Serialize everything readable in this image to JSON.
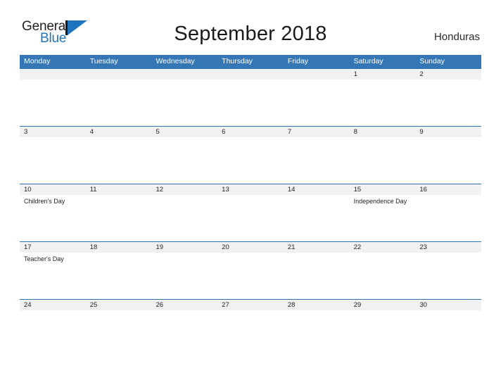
{
  "brand": {
    "name_part1": "General",
    "name_part2": "Blue",
    "mark_icon": "triangle-play-icon"
  },
  "header": {
    "title": "September 2018",
    "region": "Honduras"
  },
  "colors": {
    "header_blue": "#3576b4",
    "rule_blue": "#2e74b5",
    "date_band_gray": "#f1f1f1",
    "brand_blue": "#1f74bd"
  },
  "weekdays": [
    "Monday",
    "Tuesday",
    "Wednesday",
    "Thursday",
    "Friday",
    "Saturday",
    "Sunday"
  ],
  "weeks": [
    {
      "days": [
        {
          "date": "",
          "event": ""
        },
        {
          "date": "",
          "event": ""
        },
        {
          "date": "",
          "event": ""
        },
        {
          "date": "",
          "event": ""
        },
        {
          "date": "",
          "event": ""
        },
        {
          "date": "1",
          "event": ""
        },
        {
          "date": "2",
          "event": ""
        }
      ]
    },
    {
      "days": [
        {
          "date": "3",
          "event": ""
        },
        {
          "date": "4",
          "event": ""
        },
        {
          "date": "5",
          "event": ""
        },
        {
          "date": "6",
          "event": ""
        },
        {
          "date": "7",
          "event": ""
        },
        {
          "date": "8",
          "event": ""
        },
        {
          "date": "9",
          "event": ""
        }
      ]
    },
    {
      "days": [
        {
          "date": "10",
          "event": "Children's Day"
        },
        {
          "date": "11",
          "event": ""
        },
        {
          "date": "12",
          "event": ""
        },
        {
          "date": "13",
          "event": ""
        },
        {
          "date": "14",
          "event": ""
        },
        {
          "date": "15",
          "event": "Independence Day"
        },
        {
          "date": "16",
          "event": ""
        }
      ]
    },
    {
      "days": [
        {
          "date": "17",
          "event": "Teacher's Day"
        },
        {
          "date": "18",
          "event": ""
        },
        {
          "date": "19",
          "event": ""
        },
        {
          "date": "20",
          "event": ""
        },
        {
          "date": "21",
          "event": ""
        },
        {
          "date": "22",
          "event": ""
        },
        {
          "date": "23",
          "event": ""
        }
      ]
    },
    {
      "days": [
        {
          "date": "24",
          "event": ""
        },
        {
          "date": "25",
          "event": ""
        },
        {
          "date": "26",
          "event": ""
        },
        {
          "date": "27",
          "event": ""
        },
        {
          "date": "28",
          "event": ""
        },
        {
          "date": "29",
          "event": ""
        },
        {
          "date": "30",
          "event": ""
        }
      ]
    }
  ]
}
